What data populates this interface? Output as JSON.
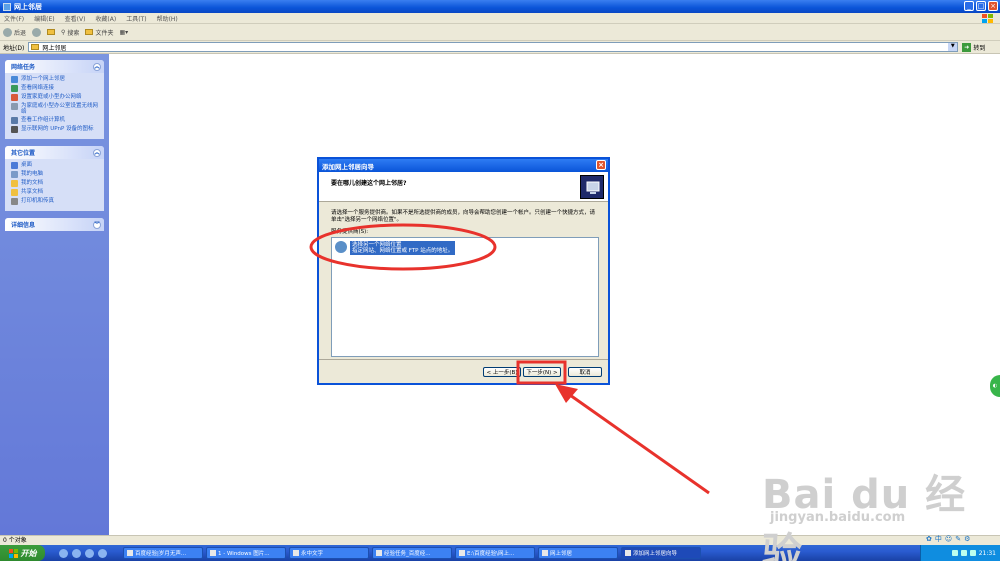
{
  "window": {
    "title": "网上邻居",
    "menus": [
      "文件(F)",
      "编辑(E)",
      "查看(V)",
      "收藏(A)",
      "工具(T)",
      "帮助(H)"
    ],
    "toolbar": {
      "back": "后退",
      "search": "搜索",
      "folders": "文件夹"
    },
    "address": {
      "label": "地址(D)",
      "value": "网上邻居",
      "go": "转到"
    },
    "status": "0 个对象"
  },
  "sidebar": {
    "network_tasks": {
      "title": "网络任务",
      "items": [
        "添加一个网上邻居",
        "查看网络连接",
        "设置家庭或小型办公网络",
        "为家庭或小型办公室设置无线网络",
        "查看工作组计算机",
        "显示联网的 UPnP 设备的图标"
      ]
    },
    "other_places": {
      "title": "其它位置",
      "items": [
        "桌面",
        "我的电脑",
        "我的文档",
        "共享文档",
        "打印机和传真"
      ]
    },
    "details": {
      "title": "详细信息"
    }
  },
  "dialog": {
    "title": "添加网上邻居向导",
    "question": "要在哪儿创建这个网上邻居?",
    "description": "请选择一个服务提供商。如果不是所选提供商的成员，向导会帮助您创建一个帐户。只创建一个快捷方式，请单击\"选择另一个网络位置\"。",
    "list_label": "服务提供商(S):",
    "list_item_title": "选择另一个网络位置",
    "list_item_desc": "指定网站、网络位置或 FTP 站点的地址。",
    "buttons": {
      "back": "< 上一步(B)",
      "next": "下一步(N) >",
      "cancel": "取消"
    }
  },
  "taskbar": {
    "start": "开始",
    "tasks": [
      "百度经验|岁月无声...",
      "1 - Windows 图片...",
      "永中文字",
      "经验任务_百度经...",
      "E:\\百度经验\\网上...",
      "网上邻居",
      "添加网上邻居向导"
    ],
    "clock": "21:31"
  },
  "watermark": {
    "brand": "Bai du 经验",
    "url": "jingyan.baidu.com"
  },
  "ime": {
    "mode": "中"
  },
  "colors": {
    "annotation": "#e8322c",
    "title_bar": "#0a54d8",
    "sidebar": "#6b86dc"
  }
}
